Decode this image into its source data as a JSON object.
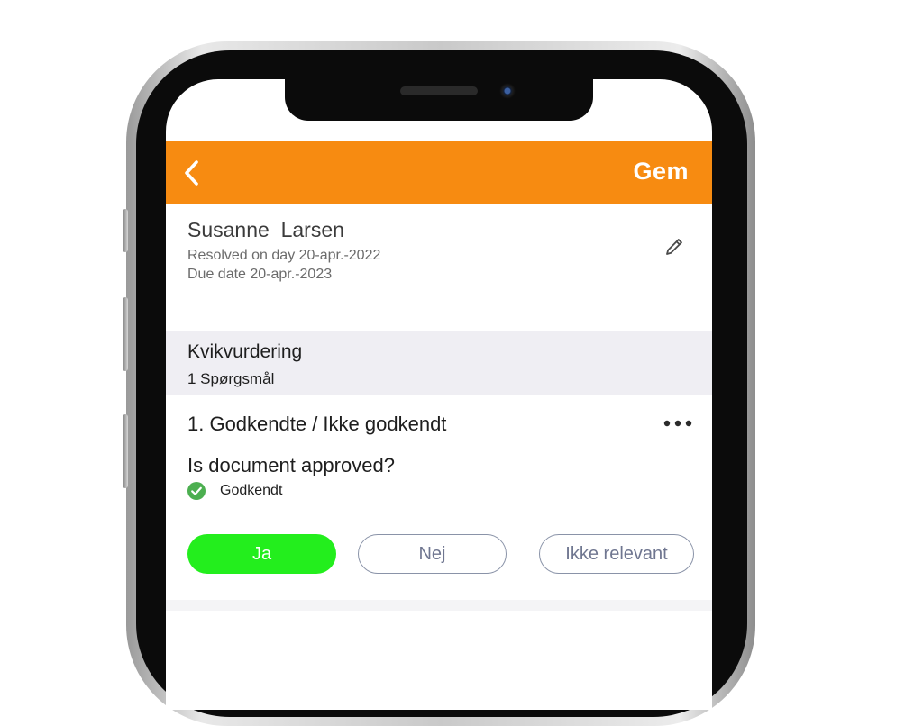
{
  "navbar": {
    "back_icon": "chevron-left-icon",
    "save_label": "Gem",
    "color": "#f78b11"
  },
  "person": {
    "name": "Susanne  Larsen",
    "resolved": "Resolved on day 20-apr.-2022",
    "due": "Due date 20-apr.-2023",
    "edit_icon": "pencil-icon"
  },
  "section": {
    "title": "Kvikvurdering",
    "subtitle": "1 Spørgsmål"
  },
  "question": {
    "title": "1. Godkendte / Ikke godkendt",
    "more_icon": "ellipsis-icon",
    "text": "Is document approved?",
    "answer_icon": "check-circle-icon",
    "answer_label": "Godkendt"
  },
  "options": {
    "yes": "Ja",
    "no": "Nej",
    "not_relevant": "Ikke relevant",
    "selected": "yes",
    "selected_color": "#23ee1d"
  }
}
